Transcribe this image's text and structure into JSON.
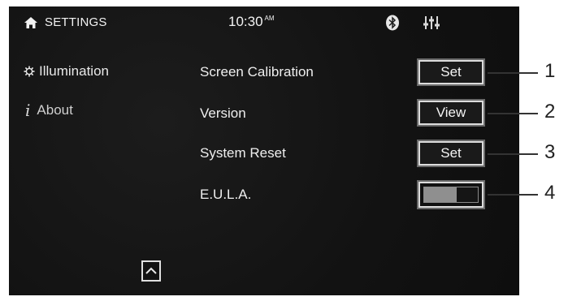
{
  "status_bar": {
    "title": "SETTINGS",
    "time": "10:30",
    "time_suffix": "AM"
  },
  "sidebar": {
    "items": [
      {
        "label": "Illumination",
        "icon": "gear-icon"
      },
      {
        "label": "About",
        "icon": "info-icon",
        "icon_glyph": "i"
      }
    ]
  },
  "settings": {
    "rows": [
      {
        "label": "Screen Calibration",
        "control": "button",
        "button_label": "Set"
      },
      {
        "label": "Version",
        "control": "button",
        "button_label": "View"
      },
      {
        "label": "System Reset",
        "control": "button",
        "button_label": "Set"
      },
      {
        "label": "E.U.L.A.",
        "control": "toggle",
        "state": "on"
      }
    ]
  },
  "callouts": [
    "1",
    "2",
    "3",
    "4"
  ],
  "icons": {
    "home": "home-icon",
    "bluetooth": "bluetooth-icon",
    "equalizer": "equalizer-icon",
    "scroll_up": "chevron-up-icon"
  }
}
